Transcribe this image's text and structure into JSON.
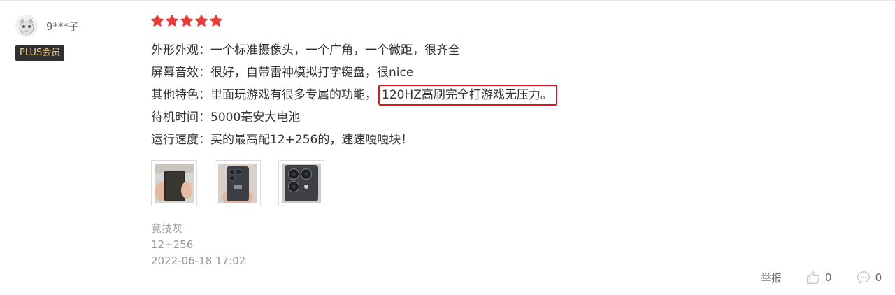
{
  "user": {
    "name": "9***子",
    "badge": "PLUS会员",
    "avatar_icon": "user-avatar"
  },
  "rating": {
    "stars": 5,
    "max": 5,
    "color": "#e83a3a"
  },
  "review": {
    "lines": [
      {
        "label": "外形外观：",
        "text": "一个标准摄像头，一个广角，一个微距，很齐全"
      },
      {
        "label": "屏幕音效：",
        "text": "很好，自带雷神模拟打字键盘，很nice"
      },
      {
        "label": "其他特色：",
        "text": "里面玩游戏有很多专属的功能，",
        "highlight": "120HZ高刷完全打游戏无压力。"
      },
      {
        "label": "待机时间：",
        "text": "5000毫安大电池"
      },
      {
        "label": "运行速度：",
        "text": "买的最高配12+256的，速速嘎嘎块！"
      }
    ],
    "highlight_color": "#e8101a"
  },
  "photos": [
    {
      "name": "phone-front-photo"
    },
    {
      "name": "phone-back-hand-photo"
    },
    {
      "name": "phone-camera-closeup-photo"
    }
  ],
  "meta": {
    "color": "竞技灰",
    "spec": "12+256",
    "date": "2022-06-18 17:02"
  },
  "actions": {
    "report": "举报",
    "like_count": "0",
    "comment_count": "0"
  }
}
